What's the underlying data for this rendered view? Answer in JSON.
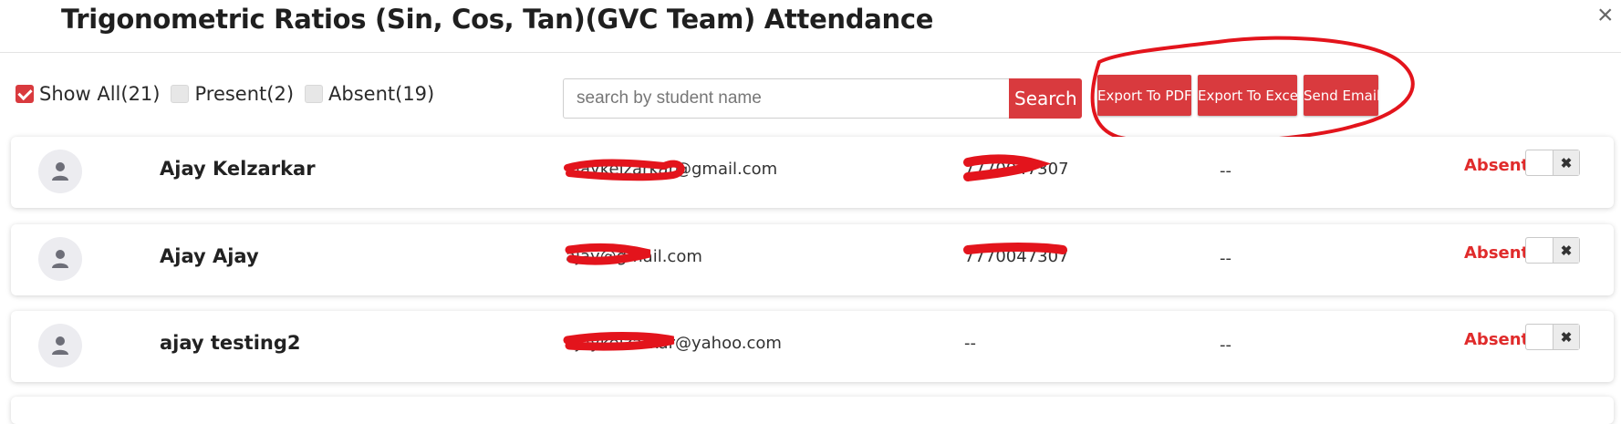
{
  "header": {
    "title": "Trigonometric Ratios (Sin, Cos, Tan)(GVC Team) Attendance",
    "close_icon": "×"
  },
  "filters": [
    {
      "label": "Show All(21)",
      "checked": true
    },
    {
      "label": "Present(2)",
      "checked": false
    },
    {
      "label": "Absent(19)",
      "checked": false
    }
  ],
  "search": {
    "placeholder": "search by student name",
    "value": "",
    "button_label": "Search"
  },
  "actions": {
    "export_pdf": "Export To PDF",
    "export_excel": "Export To Excel",
    "send_email": "Send Email"
  },
  "annotation_color": "#e3141c",
  "students": [
    {
      "name": "Ajay Kelzarkar",
      "email": "ajaykelzarkar@gmail.com",
      "phone": "7770047307",
      "extra": "--",
      "status": "Absent",
      "toggle_icon": "✖"
    },
    {
      "name": "Ajay Ajay",
      "email": "ajay@gmail.com",
      "phone": "7770047307",
      "extra": "--",
      "status": "Absent",
      "toggle_icon": "✖"
    },
    {
      "name": "ajay testing2",
      "email": "ajaykelzarkar@yahoo.com",
      "phone": "--",
      "extra": "--",
      "status": "Absent",
      "toggle_icon": "✖"
    }
  ]
}
